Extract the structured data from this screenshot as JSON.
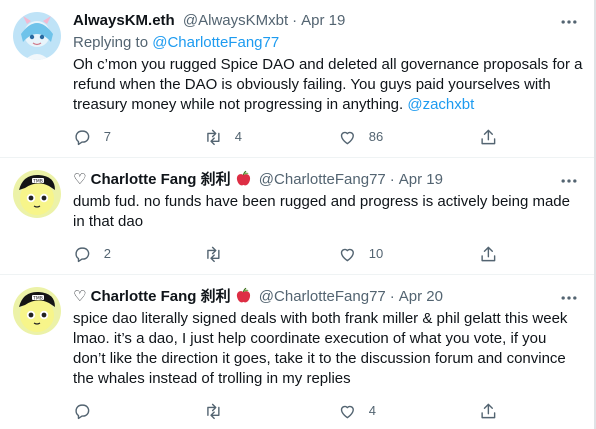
{
  "tweets": [
    {
      "name": "AlwaysKM.eth",
      "handle": "@AlwaysKMxbt",
      "date": "Apr 19",
      "replying_prefix": "Replying to ",
      "replying_to": "@CharlotteFang77",
      "text_main": "Oh c’mon you rugged Spice DAO and deleted all governance proposals for a refund when the DAO is obviously failing. You guys paid yourselves with treasury money while not progressing in anything. ",
      "text_mention": "@zachxbt",
      "replies": "7",
      "retweets": "4",
      "likes": "86"
    },
    {
      "name": "♡ Charlotte Fang 刹利",
      "handle": "@CharlotteFang77",
      "date": "Apr 19",
      "text": "dumb fud. no funds have been rugged and progress is actively being made in that dao",
      "replies": "2",
      "retweets": "",
      "likes": "10"
    },
    {
      "name": "♡ Charlotte Fang 刹利",
      "handle": "@CharlotteFang77",
      "date": "Apr 20",
      "text": "spice dao literally signed deals with both frank miller & phil gelatt this week lmao. it’s a dao, I just help coordinate execution of what you vote, if you don’t like the direction it goes, take it to the discussion forum and convince the whales instead of trolling in my replies",
      "replies": "",
      "retweets": "",
      "likes": "4"
    }
  ],
  "separator": "·",
  "colors": {
    "text": "#0f1419",
    "secondary": "#536471",
    "link": "#1d9bf0",
    "divider": "#eff3f4"
  },
  "icons": [
    "reply-icon",
    "retweet-icon",
    "like-icon",
    "share-icon",
    "more-icon",
    "apple-emoji-icon"
  ]
}
